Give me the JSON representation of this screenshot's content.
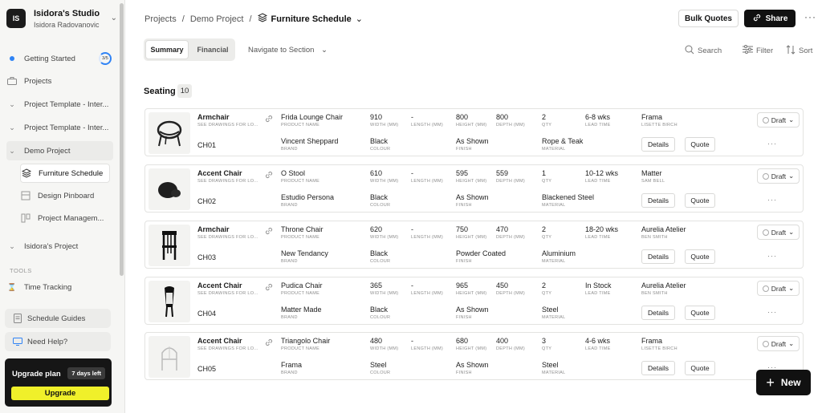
{
  "workspace": {
    "avatar": "IS",
    "name": "Isidora's Studio",
    "user": "Isidora Radovanovic"
  },
  "sidebar": {
    "getting_started": {
      "label": "Getting Started",
      "progress": "3/5"
    },
    "projects_label": "Projects",
    "items": [
      {
        "label": "Project Template - Inter..."
      },
      {
        "label": "Project Template - Inter..."
      },
      {
        "label": "Demo Project"
      },
      {
        "label": "Furniture Schedule"
      },
      {
        "label": "Design Pinboard"
      },
      {
        "label": "Project Managem..."
      },
      {
        "label": "Isidora's Project"
      }
    ],
    "tools_label": "TOOLS",
    "time_tracking": "Time Tracking",
    "schedule_guides": "Schedule Guides",
    "need_help": "Need Help?",
    "upgrade": {
      "title": "Upgrade plan",
      "badge": "7 days left",
      "button": "Upgrade"
    }
  },
  "breadcrumb": {
    "projects": "Projects",
    "project": "Demo Project",
    "current": "Furniture Schedule",
    "sep": "/"
  },
  "header": {
    "bulk_quotes": "Bulk Quotes",
    "share": "Share"
  },
  "view_tabs": {
    "summary": "Summary",
    "financial": "Financial"
  },
  "navigate": "Navigate to Section",
  "tools": {
    "search": "Search",
    "filter": "Filter",
    "sort": "Sort"
  },
  "section": {
    "title": "Seating",
    "count": "10"
  },
  "labels": {
    "drawings": "SEE DRAWINGS FOR LO...",
    "product_name": "PRODUCT NAME",
    "brand": "BRAND",
    "width": "WIDTH (MM)",
    "length": "LENGTH (MM)",
    "height": "HEIGHT (MM)",
    "depth": "DEPTH (MM)",
    "colour": "COLOUR",
    "finish": "FINISH",
    "qty": "QTY",
    "material": "MATERIAL",
    "lead_time": "LEAD TIME",
    "details": "Details",
    "quote": "Quote",
    "draft": "Draft"
  },
  "rows": [
    {
      "type": "Armchair",
      "code": "CH01",
      "product": "Frida Lounge Chair",
      "brand": "Vincent Sheppard",
      "width": "910",
      "length": "-",
      "height": "800",
      "depth": "800",
      "colour": "Black",
      "finish": "As Shown",
      "qty": "2",
      "material": "Rope & Teak",
      "lead": "6-8 wks",
      "supplier": "Frama",
      "designer": "LISETTE BIRCH"
    },
    {
      "type": "Accent Chair",
      "code": "CH02",
      "product": "O Stool",
      "brand": "Estudio Persona",
      "width": "610",
      "length": "-",
      "height": "595",
      "depth": "559",
      "colour": "Black",
      "finish": "As Shown",
      "qty": "1",
      "material": "Blackened Steel",
      "lead": "10-12 wks",
      "supplier": "Matter",
      "designer": "SAM BELL"
    },
    {
      "type": "Armchair",
      "code": "CH03",
      "product": "Throne Chair",
      "brand": "New Tendancy",
      "width": "620",
      "length": "-",
      "height": "750",
      "depth": "470",
      "colour": "Black",
      "finish": "Powder Coated",
      "qty": "2",
      "material": "Aluminium",
      "lead": "18-20 wks",
      "supplier": "Aurelia Atelier",
      "designer": "BEN SMITH"
    },
    {
      "type": "Accent Chair",
      "code": "CH04",
      "product": "Pudica Chair",
      "brand": "Matter Made",
      "width": "365",
      "length": "-",
      "height": "965",
      "depth": "450",
      "colour": "Black",
      "finish": "As Shown",
      "qty": "2",
      "material": "Steel",
      "lead": "In Stock",
      "supplier": "Aurelia Atelier",
      "designer": "BEN SMITH"
    },
    {
      "type": "Accent Chair",
      "code": "CH05",
      "product": "Triangolo Chair",
      "brand": "Frama",
      "width": "480",
      "length": "-",
      "height": "680",
      "depth": "400",
      "colour": "Steel",
      "finish": "As Shown",
      "qty": "3",
      "material": "Steel",
      "lead": "4-6 wks",
      "supplier": "Frama",
      "designer": "LISETTE BIRCH"
    }
  ],
  "new_button": "New",
  "colors": {
    "accent_blue": "#2f83f5",
    "upgrade_yellow": "#f0f02a",
    "dark": "#111111"
  }
}
